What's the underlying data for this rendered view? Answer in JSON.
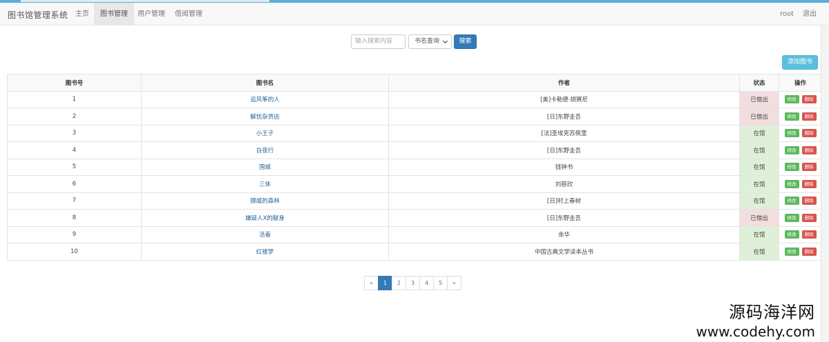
{
  "navbar": {
    "brand": "图书馆管理系统",
    "items": [
      {
        "label": "主页",
        "active": false
      },
      {
        "label": "图书管理",
        "active": true
      },
      {
        "label": "用户管理",
        "active": false
      },
      {
        "label": "借阅管理",
        "active": false
      }
    ],
    "user": "root",
    "logout": "退出"
  },
  "search": {
    "placeholder": "输入搜索内容",
    "select_value": "书名查询",
    "button": "搜索"
  },
  "add_button": "添加图书",
  "table": {
    "headers": [
      "图书号",
      "图书名",
      "作者",
      "状态",
      "操作"
    ],
    "rows": [
      {
        "id": "1",
        "name": "追风筝的人",
        "author": "[美]卡勒德·胡赛尼",
        "status": "已借出",
        "out": true
      },
      {
        "id": "2",
        "name": "解忧杂货店",
        "author": "[日]东野圭吾",
        "status": "已借出",
        "out": true
      },
      {
        "id": "3",
        "name": "小王子",
        "author": "[法]圣埃克苏佩里",
        "status": "在馆",
        "out": false
      },
      {
        "id": "4",
        "name": "白夜行",
        "author": "[日]东野圭吾",
        "status": "在馆",
        "out": false
      },
      {
        "id": "5",
        "name": "围城",
        "author": "钱钟书",
        "status": "在馆",
        "out": false
      },
      {
        "id": "6",
        "name": "三体",
        "author": "刘慈欣",
        "status": "在馆",
        "out": false
      },
      {
        "id": "7",
        "name": "挪威的森林",
        "author": "[日]村上春树",
        "status": "在馆",
        "out": false
      },
      {
        "id": "8",
        "name": "嫌疑人X的献身",
        "author": "[日]东野圭吾",
        "status": "已借出",
        "out": true
      },
      {
        "id": "9",
        "name": "活着",
        "author": "余华",
        "status": "在馆",
        "out": false
      },
      {
        "id": "10",
        "name": "红楼梦",
        "author": "中国古典文学读本丛书",
        "status": "在馆",
        "out": false
      }
    ],
    "edit_label": "修改",
    "delete_label": "删除"
  },
  "pagination": {
    "prev": "«",
    "pages": [
      "1",
      "2",
      "3",
      "4",
      "5"
    ],
    "current": "1",
    "next": "»"
  },
  "watermark": {
    "line1": "源码海洋网",
    "line2": "www.codehy.com"
  },
  "colors": {
    "primary": "#337ab7",
    "info": "#5bc0de",
    "success": "#5cb85c",
    "danger": "#d9534f",
    "status_out_bg": "#f2dede",
    "status_in_bg": "#dff0d8"
  }
}
